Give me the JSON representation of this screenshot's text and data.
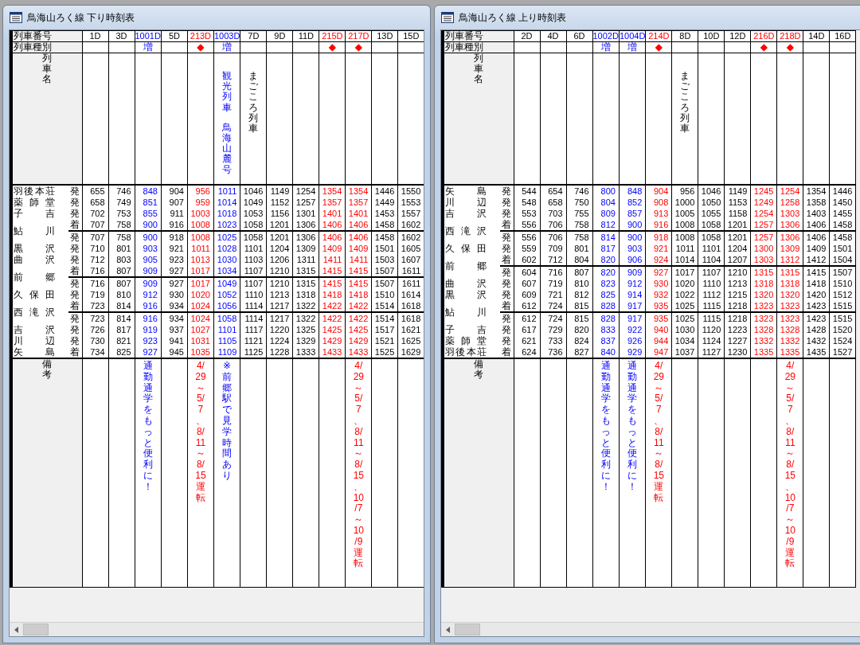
{
  "windows": [
    {
      "title": "鳥海山ろく線 下り時刻表",
      "labels": {
        "number": "列車番号",
        "type": "列車種別",
        "name": "列車名",
        "remarks": "備考"
      },
      "stations": [
        {
          "name": "羽後本荘",
          "stops": [
            "発"
          ]
        },
        {
          "name": "薬師堂",
          "stops": [
            "発"
          ]
        },
        {
          "name": "子吉",
          "stops": [
            "発"
          ]
        },
        {
          "name": "鮎川",
          "stops": [
            "着",
            "発"
          ]
        },
        {
          "name": "黒沢",
          "stops": [
            "発"
          ]
        },
        {
          "name": "曲沢",
          "stops": [
            "発"
          ]
        },
        {
          "name": "前郷",
          "stops": [
            "着",
            "発"
          ]
        },
        {
          "name": "久保田",
          "stops": [
            "発"
          ]
        },
        {
          "name": "西滝沢",
          "stops": [
            "着",
            "発"
          ]
        },
        {
          "name": "吉沢",
          "stops": [
            "発"
          ]
        },
        {
          "name": "川辺",
          "stops": [
            "発"
          ]
        },
        {
          "name": "矢島",
          "stops": [
            "着"
          ]
        }
      ],
      "trains": [
        {
          "number": "1D",
          "color": "#000000",
          "times": [
            "655",
            "658",
            "702",
            "707",
            "707",
            "710",
            "712",
            "716",
            "716",
            "719",
            "723",
            "723",
            "726",
            "730",
            "734"
          ]
        },
        {
          "number": "3D",
          "color": "#000000",
          "times": [
            "746",
            "749",
            "753",
            "758",
            "758",
            "801",
            "803",
            "807",
            "807",
            "810",
            "814",
            "814",
            "817",
            "821",
            "825"
          ]
        },
        {
          "number": "1001D",
          "color": "#0000ff",
          "type": "増",
          "times": [
            "848",
            "851",
            "855",
            "900",
            "900",
            "903",
            "905",
            "909",
            "909",
            "912",
            "916",
            "916",
            "919",
            "923",
            "927"
          ],
          "remarks": "通勤通学をもっと便利に！"
        },
        {
          "number": "5D",
          "color": "#000000",
          "times": [
            "904",
            "907",
            "911",
            "916",
            "918",
            "921",
            "923",
            "927",
            "927",
            "930",
            "934",
            "934",
            "937",
            "941",
            "945"
          ]
        },
        {
          "number": "213D",
          "color": "#ff0000",
          "type": "◆",
          "times": [
            "956",
            "959",
            "1003",
            "1008",
            "1008",
            "1011",
            "1013",
            "1017",
            "1017",
            "1020",
            "1024",
            "1024",
            "1027",
            "1031",
            "1035"
          ],
          "remarks": "4/29～5/7、8/11～8/15　運転"
        },
        {
          "number": "1003D",
          "color": "#0000ff",
          "type": "増",
          "name": [
            "観光列車",
            "鳥海山麓号"
          ],
          "times": [
            "1011",
            "1014",
            "1018",
            "1023",
            "1025",
            "1028",
            "1030",
            "1034",
            "1049",
            "1052",
            "1056",
            "1058",
            "1101",
            "1105",
            "1109"
          ],
          "remarks": "※前郷駅で見学時間あり"
        },
        {
          "number": "7D",
          "color": "#000000",
          "name": [
            "まごころ列車"
          ],
          "times": [
            "1046",
            "1049",
            "1053",
            "1058",
            "1058",
            "1101",
            "1103",
            "1107",
            "1107",
            "1110",
            "1114",
            "1114",
            "1117",
            "1121",
            "1125"
          ]
        },
        {
          "number": "9D",
          "color": "#000000",
          "times": [
            "1149",
            "1152",
            "1156",
            "1201",
            "1201",
            "1204",
            "1206",
            "1210",
            "1210",
            "1213",
            "1217",
            "1217",
            "1220",
            "1224",
            "1228"
          ]
        },
        {
          "number": "11D",
          "color": "#000000",
          "times": [
            "1254",
            "1257",
            "1301",
            "1306",
            "1306",
            "1309",
            "1311",
            "1315",
            "1315",
            "1318",
            "1322",
            "1322",
            "1325",
            "1329",
            "1333"
          ]
        },
        {
          "number": "215D",
          "color": "#ff0000",
          "type": "◆",
          "times": [
            "1354",
            "1357",
            "1401",
            "1406",
            "1406",
            "1409",
            "1411",
            "1415",
            "1415",
            "1418",
            "1422",
            "1422",
            "1425",
            "1429",
            "1433"
          ]
        },
        {
          "number": "217D",
          "color": "#ff0000",
          "type": "◆",
          "times": [
            "1354",
            "1357",
            "1401",
            "1406",
            "1406",
            "1409",
            "1411",
            "1415",
            "1415",
            "1418",
            "1422",
            "1422",
            "1425",
            "1429",
            "1433"
          ],
          "remarks": "4/29～5/7、8/11～8/15、10/7～10/9　運転"
        },
        {
          "number": "13D",
          "color": "#000000",
          "times": [
            "1446",
            "1449",
            "1453",
            "1458",
            "1458",
            "1501",
            "1503",
            "1507",
            "1507",
            "1510",
            "1514",
            "1514",
            "1517",
            "1521",
            "1525"
          ]
        },
        {
          "number": "15D",
          "color": "#000000",
          "times": [
            "1550",
            "1553",
            "1557",
            "1602",
            "1602",
            "1605",
            "1607",
            "1611",
            "1611",
            "1614",
            "1618",
            "1618",
            "1621",
            "1625",
            "1629"
          ]
        }
      ]
    },
    {
      "title": "鳥海山ろく線 上り時刻表",
      "labels": {
        "number": "列車番号",
        "type": "列車種別",
        "name": "列車名",
        "remarks": "備考"
      },
      "stations": [
        {
          "name": "矢島",
          "stops": [
            "発"
          ]
        },
        {
          "name": "川辺",
          "stops": [
            "発"
          ]
        },
        {
          "name": "吉沢",
          "stops": [
            "発"
          ]
        },
        {
          "name": "西滝沢",
          "stops": [
            "着",
            "発"
          ]
        },
        {
          "name": "久保田",
          "stops": [
            "発"
          ]
        },
        {
          "name": "前郷",
          "stops": [
            "着",
            "発"
          ]
        },
        {
          "name": "曲沢",
          "stops": [
            "発"
          ]
        },
        {
          "name": "黒沢",
          "stops": [
            "発"
          ]
        },
        {
          "name": "鮎川",
          "stops": [
            "着",
            "発"
          ]
        },
        {
          "name": "子吉",
          "stops": [
            "発"
          ]
        },
        {
          "name": "薬師堂",
          "stops": [
            "発"
          ]
        },
        {
          "name": "羽後本荘",
          "stops": [
            "着"
          ]
        }
      ],
      "trains": [
        {
          "number": "2D",
          "color": "#000000",
          "times": [
            "544",
            "548",
            "553",
            "556",
            "556",
            "559",
            "602",
            "604",
            "607",
            "609",
            "612",
            "612",
            "617",
            "621",
            "624"
          ]
        },
        {
          "number": "4D",
          "color": "#000000",
          "times": [
            "654",
            "658",
            "703",
            "706",
            "706",
            "709",
            "712",
            "716",
            "719",
            "721",
            "724",
            "724",
            "729",
            "733",
            "736"
          ]
        },
        {
          "number": "6D",
          "color": "#000000",
          "times": [
            "746",
            "750",
            "755",
            "758",
            "758",
            "801",
            "804",
            "807",
            "810",
            "812",
            "815",
            "815",
            "820",
            "824",
            "827"
          ]
        },
        {
          "number": "1002D",
          "color": "#0000ff",
          "type": "増",
          "times": [
            "800",
            "804",
            "809",
            "812",
            "814",
            "817",
            "820",
            "820",
            "823",
            "825",
            "828",
            "828",
            "833",
            "837",
            "840"
          ],
          "remarks": "通勤通学をもっと便利に！"
        },
        {
          "number": "1004D",
          "color": "#0000ff",
          "type": "増",
          "times": [
            "848",
            "852",
            "857",
            "900",
            "900",
            "903",
            "906",
            "909",
            "912",
            "914",
            "917",
            "917",
            "922",
            "926",
            "929"
          ],
          "remarks": "通勤通学をもっと便利に！"
        },
        {
          "number": "214D",
          "color": "#ff0000",
          "type": "◆",
          "times": [
            "904",
            "908",
            "913",
            "916",
            "918",
            "921",
            "924",
            "927",
            "930",
            "932",
            "935",
            "935",
            "940",
            "944",
            "947"
          ],
          "remarks": "4/29～5/7、8/11～8/15　運転"
        },
        {
          "number": "8D",
          "color": "#000000",
          "name": [
            "まごころ列車"
          ],
          "times": [
            "956",
            "1000",
            "1005",
            "1008",
            "1008",
            "1011",
            "1014",
            "1017",
            "1020",
            "1022",
            "1025",
            "1025",
            "1030",
            "1034",
            "1037"
          ]
        },
        {
          "number": "10D",
          "color": "#000000",
          "times": [
            "1046",
            "1050",
            "1055",
            "1058",
            "1058",
            "1101",
            "1104",
            "1107",
            "1110",
            "1112",
            "1115",
            "1115",
            "1120",
            "1124",
            "1127"
          ]
        },
        {
          "number": "12D",
          "color": "#000000",
          "times": [
            "1149",
            "1153",
            "1158",
            "1201",
            "1201",
            "1204",
            "1207",
            "1210",
            "1213",
            "1215",
            "1218",
            "1218",
            "1223",
            "1227",
            "1230"
          ]
        },
        {
          "number": "216D",
          "color": "#ff0000",
          "type": "◆",
          "times": [
            "1245",
            "1249",
            "1254",
            "1257",
            "1257",
            "1300",
            "1303",
            "1315",
            "1318",
            "1320",
            "1323",
            "1323",
            "1328",
            "1332",
            "1335"
          ]
        },
        {
          "number": "218D",
          "color": "#ff0000",
          "type": "◆",
          "times": [
            "1254",
            "1258",
            "1303",
            "1306",
            "1306",
            "1309",
            "1312",
            "1315",
            "1318",
            "1320",
            "1323",
            "1323",
            "1328",
            "1332",
            "1335"
          ],
          "remarks": "4/29～5/7、8/11～8/15、10/7～10/9　運転"
        },
        {
          "number": "14D",
          "color": "#000000",
          "times": [
            "1354",
            "1358",
            "1403",
            "1406",
            "1406",
            "1409",
            "1412",
            "1415",
            "1418",
            "1420",
            "1423",
            "1423",
            "1428",
            "1432",
            "1435"
          ]
        },
        {
          "number": "16D",
          "color": "#000000",
          "times": [
            "1446",
            "1450",
            "1455",
            "1458",
            "1458",
            "1501",
            "1504",
            "1507",
            "1510",
            "1512",
            "1515",
            "1515",
            "1520",
            "1524",
            "1527"
          ]
        }
      ]
    }
  ]
}
